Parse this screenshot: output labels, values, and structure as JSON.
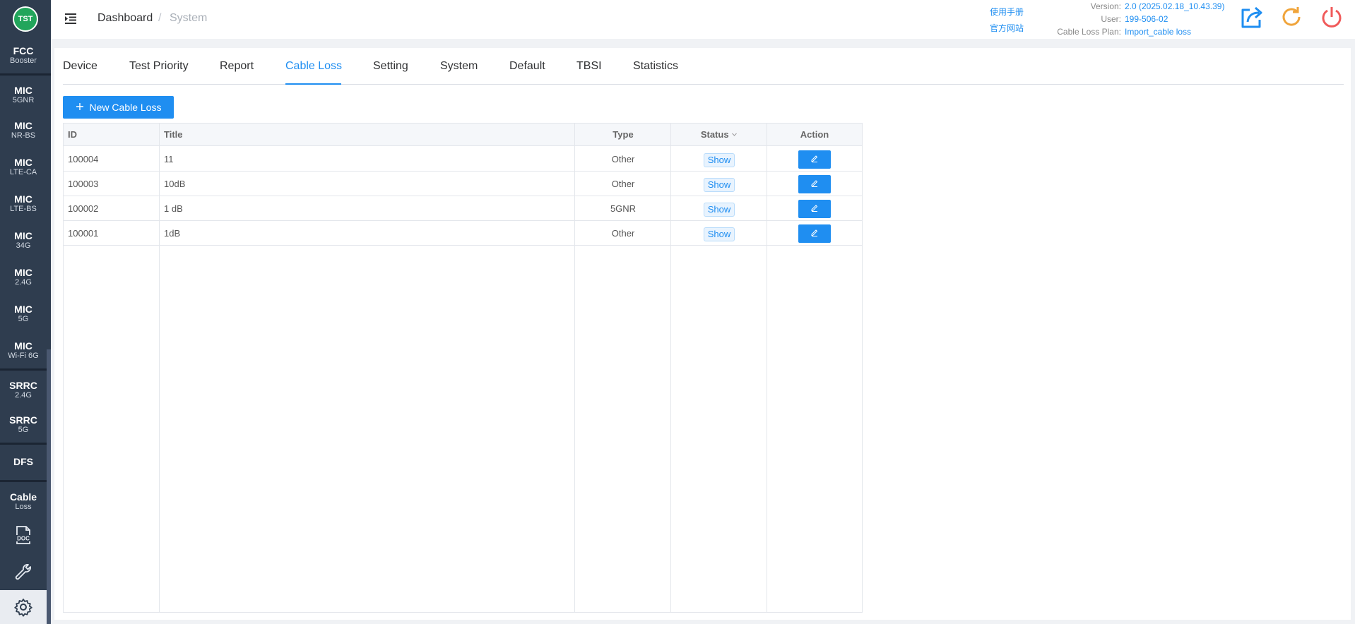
{
  "sidebar": {
    "logo": "TST",
    "items": [
      {
        "t1": "FCC",
        "t2": "Booster"
      },
      {
        "t1": "MIC",
        "t2": "5GNR"
      },
      {
        "t1": "MIC",
        "t2": "NR-BS"
      },
      {
        "t1": "MIC",
        "t2": "LTE-CA"
      },
      {
        "t1": "MIC",
        "t2": "LTE-BS"
      },
      {
        "t1": "MIC",
        "t2": "34G"
      },
      {
        "t1": "MIC",
        "t2": "2.4G"
      },
      {
        "t1": "MIC",
        "t2": "5G"
      },
      {
        "t1": "MIC",
        "t2": "Wi-Fi 6G"
      },
      {
        "t1": "SRRC",
        "t2": "2.4G"
      },
      {
        "t1": "SRRC",
        "t2": "5G"
      },
      {
        "t1": "DFS",
        "t2": ""
      },
      {
        "t1": "Cable",
        "t2": "Loss"
      }
    ],
    "doc_label": "DOC"
  },
  "header": {
    "breadcrumb": [
      "Dashboard",
      "System"
    ],
    "links": [
      "使用手册",
      "官方网站"
    ],
    "info": [
      {
        "label": "Version:",
        "value": "2.0 (2025.02.18_10.43.39)"
      },
      {
        "label": "User:",
        "value": "199-506-02"
      },
      {
        "label": "Cable Loss Plan:",
        "value": "Import_cable loss"
      }
    ]
  },
  "tabs": [
    "Device",
    "Test Priority",
    "Report",
    "Cable Loss",
    "Setting",
    "System",
    "Default",
    "TBSI",
    "Statistics"
  ],
  "active_tab": "Cable Loss",
  "new_button_label": "New Cable Loss",
  "table": {
    "headers": {
      "id": "ID",
      "title": "Title",
      "type": "Type",
      "status": "Status",
      "action": "Action"
    },
    "rows": [
      {
        "id": "100004",
        "title": "11",
        "type": "Other",
        "status": "Show"
      },
      {
        "id": "100003",
        "title": "10dB",
        "type": "Other",
        "status": "Show"
      },
      {
        "id": "100002",
        "title": "1 dB",
        "type": "5GNR",
        "status": "Show"
      },
      {
        "id": "100001",
        "title": "1dB",
        "type": "Other",
        "status": "Show"
      }
    ]
  },
  "colors": {
    "accent": "#1f8ef1",
    "sidebar": "#2f3d4f",
    "logo_green": "#22a55b",
    "refresh_orange": "#f0a43a",
    "power_red": "#f05a5a"
  }
}
